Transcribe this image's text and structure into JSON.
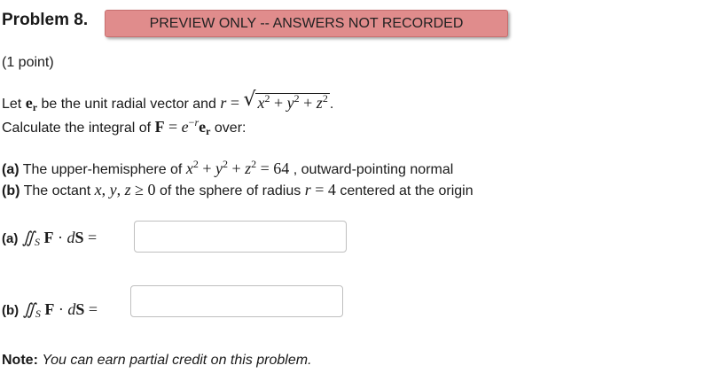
{
  "header": {
    "problem_title": "Problem 8.",
    "preview_badge": "PREVIEW ONLY -- ANSWERS NOT RECORDED"
  },
  "points": "(1 point)",
  "statement": {
    "line1_prefix": "Let",
    "line1_be": "be the unit radial vector and",
    "line1_end": ".",
    "line2_prefix": "Calculate the integral of",
    "line2_suffix": "over:"
  },
  "parts": {
    "a_label": "(a)",
    "a_text_prefix": "The upper-hemisphere of",
    "a_text_suffix": ", outward-pointing normal",
    "b_label": "(b)",
    "b_text_prefix": "The octant",
    "b_text_middle": "of the sphere of radius",
    "b_text_suffix": "centered at the origin"
  },
  "answers": {
    "a_label": "(a)",
    "a_value": "",
    "b_label": "(b)",
    "b_value": ""
  },
  "note": {
    "label": "Note",
    "text": "You can earn partial credit on this problem."
  }
}
